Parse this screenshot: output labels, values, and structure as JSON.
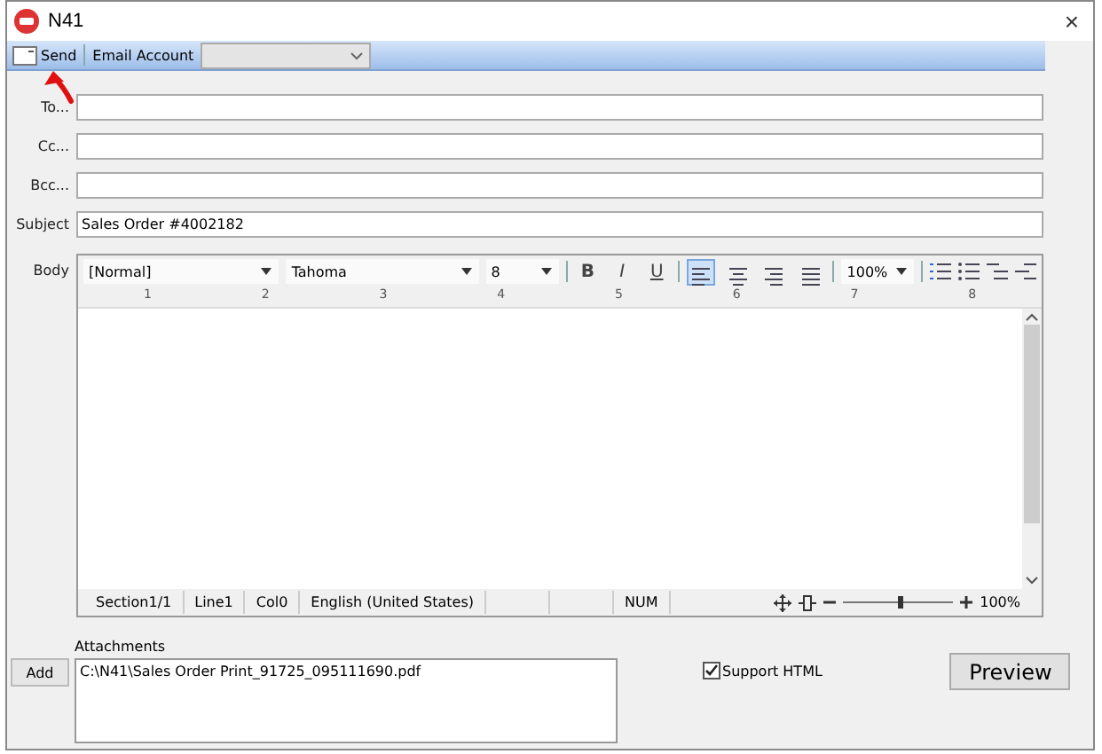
{
  "window": {
    "title": "N41",
    "close": "×"
  },
  "toolbar": {
    "send": "Send",
    "account_label": "Email Account"
  },
  "fields": [
    {
      "label": "To..."
    },
    {
      "label": "Cc..."
    },
    {
      "label": "Bcc..."
    },
    {
      "label": "Subject",
      "value": "Sales Order #4002182"
    }
  ],
  "body": {
    "label": "Body",
    "style": "[Normal]",
    "font": "Tahoma",
    "size": "8",
    "zoom": "100%",
    "format": [
      {
        "label": "B",
        "kind": "bold"
      },
      {
        "label": "I",
        "kind": "italic"
      },
      {
        "label": "U",
        "kind": "underline"
      }
    ],
    "alignments": [
      {
        "kind": "left",
        "selected": true
      },
      {
        "kind": "center",
        "selected": false
      },
      {
        "kind": "right",
        "selected": false
      },
      {
        "kind": "justify",
        "selected": false
      }
    ],
    "ruler": [
      "1",
      "2",
      "3",
      "4",
      "5",
      "6",
      "7",
      "8"
    ],
    "status": [
      {
        "kind": "text",
        "text": "Section1/1"
      },
      {
        "kind": "text",
        "text": "Line1"
      },
      {
        "kind": "text",
        "text": "Col0"
      },
      {
        "kind": "text",
        "text": "English (United States)"
      },
      {
        "kind": "blank"
      },
      {
        "kind": "blank"
      },
      {
        "kind": "text",
        "text": "NUM"
      }
    ],
    "zoom_slider": {
      "level": 0.5,
      "reading": "100%"
    }
  },
  "attachments": {
    "label": "Attachments",
    "add": "Add",
    "items": [
      "C:\\N41\\Sales Order Print_91725_095111690.pdf"
    ]
  },
  "support_html": {
    "label": "Support HTML",
    "checked": true
  },
  "preview": "Preview"
}
